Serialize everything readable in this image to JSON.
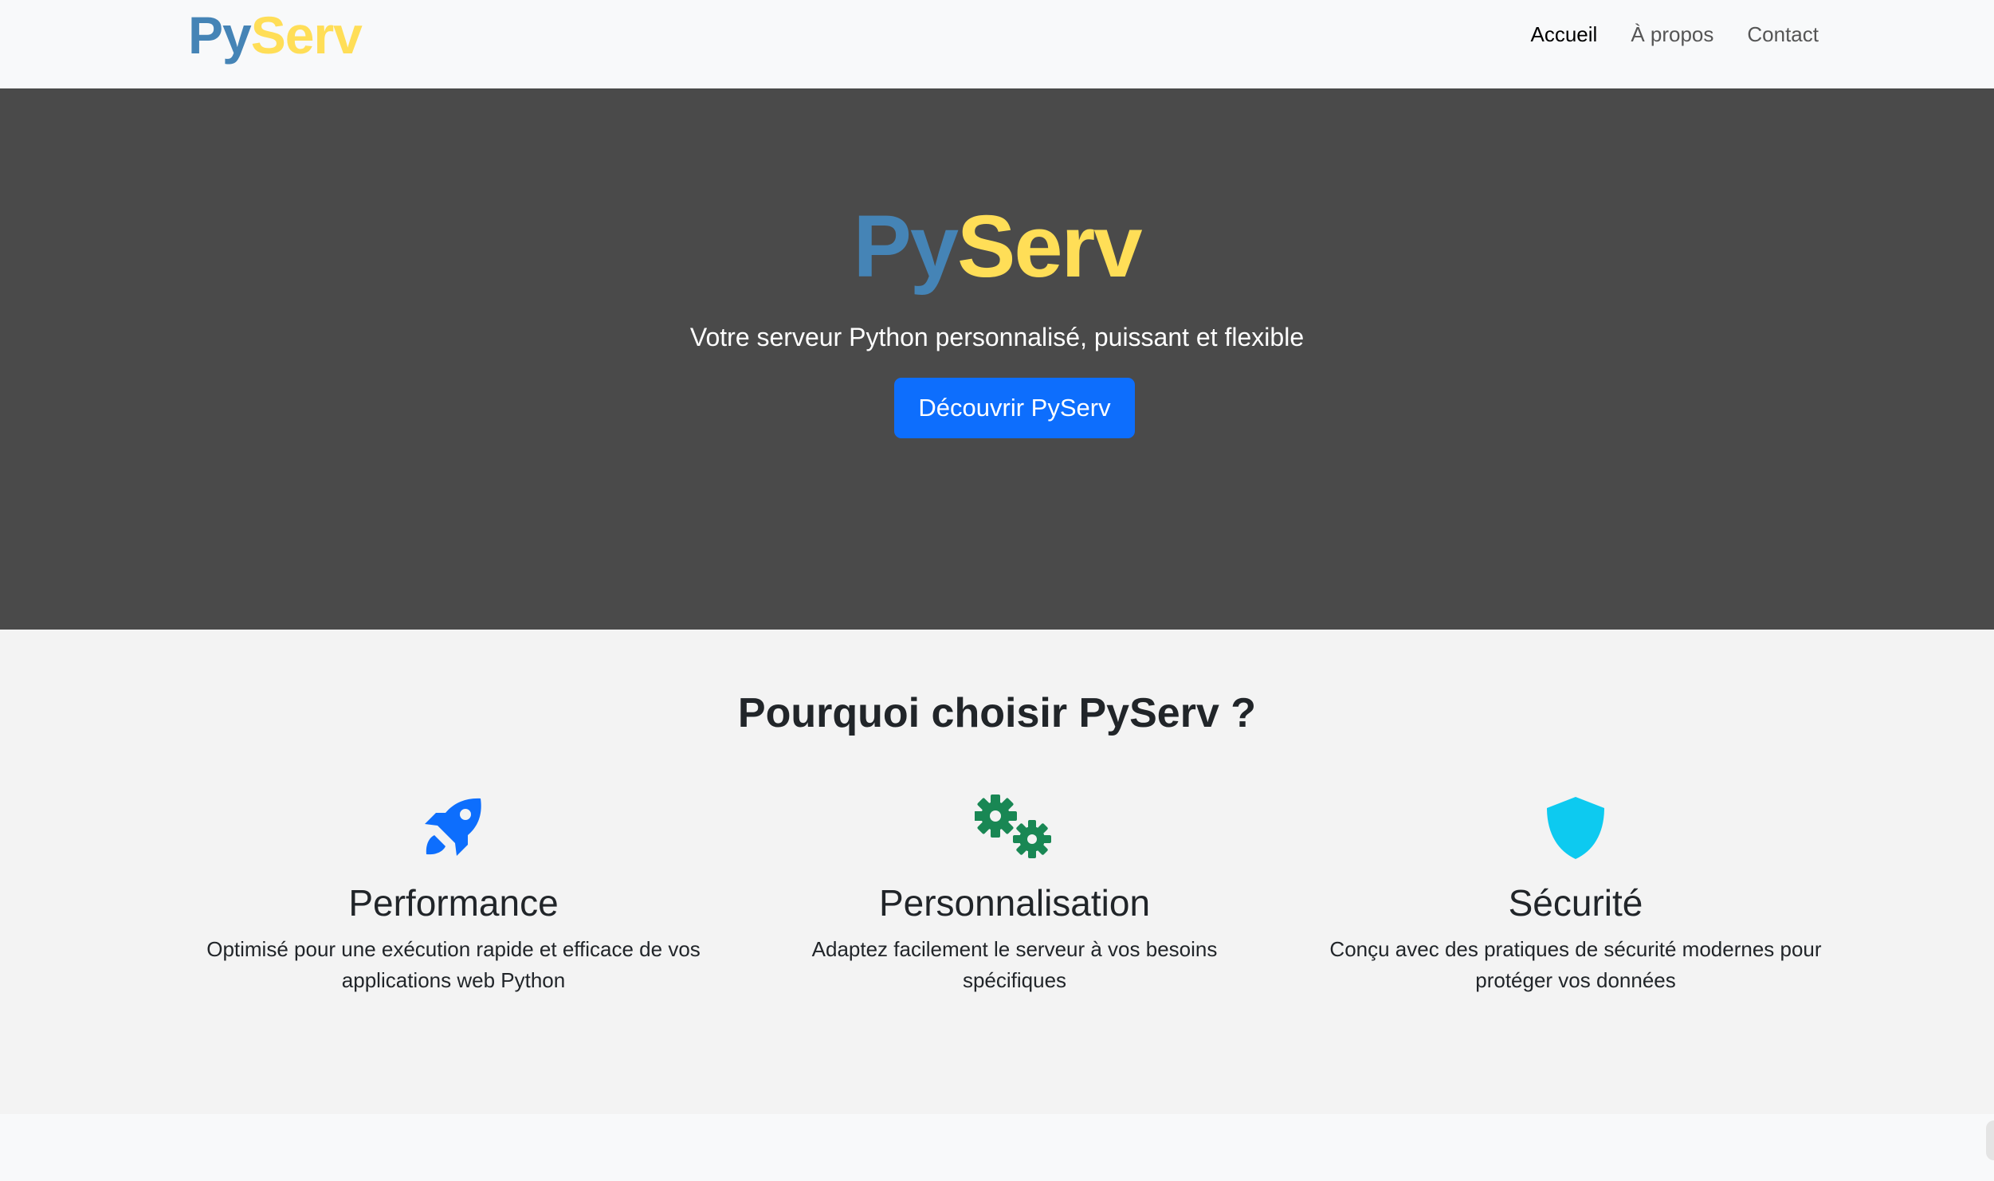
{
  "brand": {
    "py": "Py",
    "serv": "Serv"
  },
  "nav": {
    "items": [
      {
        "label": "Accueil",
        "active": true
      },
      {
        "label": "À propos",
        "active": false
      },
      {
        "label": "Contact",
        "active": false
      }
    ]
  },
  "hero": {
    "title_py": "Py",
    "title_serv": "Serv",
    "subtitle": "Votre serveur Python personnalisé, puissant et flexible",
    "button_label": "Découvrir PyServ"
  },
  "features": {
    "title": "Pourquoi choisir PyServ ?",
    "items": [
      {
        "icon": "rocket-icon",
        "title": "Performance",
        "text": "Optimisé pour une exécution rapide et efficace de vos applications web Python"
      },
      {
        "icon": "gears-icon",
        "title": "Personnalisation",
        "text": "Adaptez facilement le serveur à vos besoins spécifiques"
      },
      {
        "icon": "shield-icon",
        "title": "Sécurité",
        "text": "Conçu avec des pratiques de sécurité modernes pour protéger vos données"
      }
    ]
  },
  "colors": {
    "python_blue": "#4584b6",
    "python_yellow": "#ffde57",
    "hero_bg": "#4a4a4a",
    "primary": "#0d6efd",
    "rocket": "#0d6efd",
    "gears": "#198754",
    "shield": "#0dcaf0"
  }
}
